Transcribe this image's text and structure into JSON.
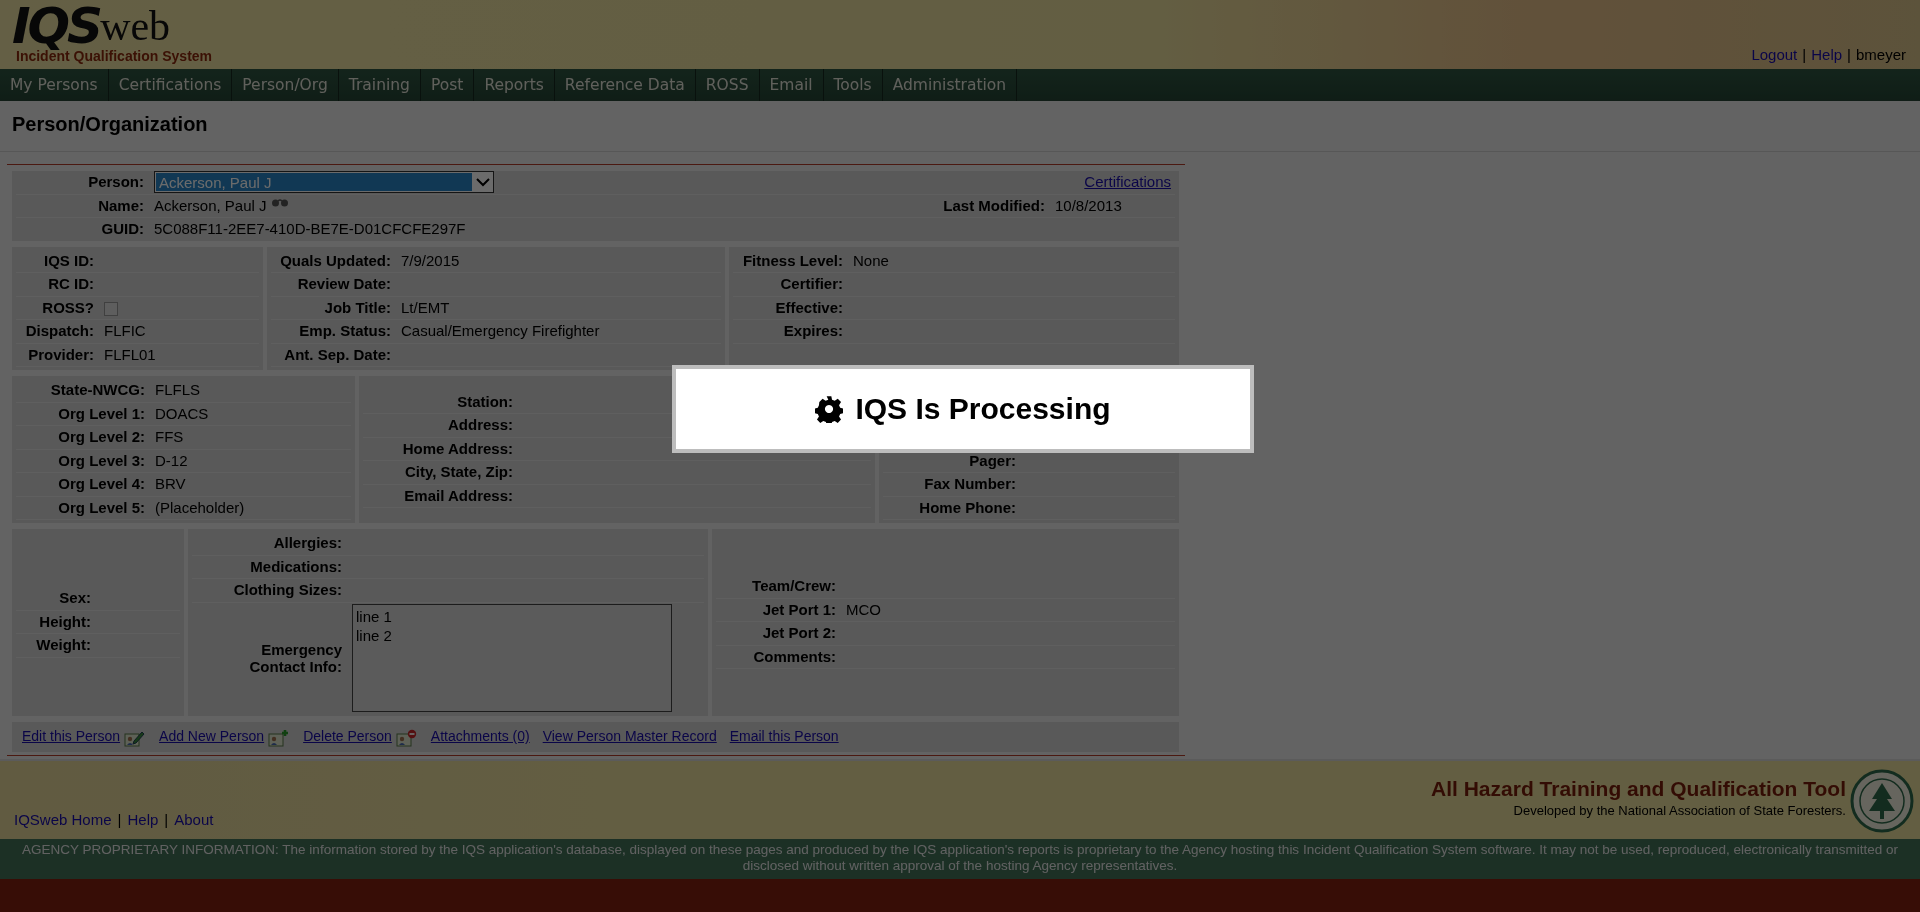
{
  "header": {
    "logo_mark": "IQS",
    "logo_word": "web",
    "logo_subtitle": "Incident Qualification System",
    "user_links": [
      {
        "label": "Logout",
        "kind": "link"
      },
      {
        "label": "|",
        "kind": "separator"
      },
      {
        "label": "Help",
        "kind": "link"
      },
      {
        "label": "|",
        "kind": "separator"
      },
      {
        "label": "bmeyer",
        "kind": "text"
      }
    ]
  },
  "nav": [
    {
      "label": "My Persons"
    },
    {
      "label": "Certifications"
    },
    {
      "label": "Person/Org"
    },
    {
      "label": "Training"
    },
    {
      "label": "Post"
    },
    {
      "label": "Reports"
    },
    {
      "label": "Reference Data"
    },
    {
      "label": "ROSS"
    },
    {
      "label": "Email"
    },
    {
      "label": "Tools"
    },
    {
      "label": "Administration"
    }
  ],
  "page_title": "Person/Organization",
  "person_panel": {
    "person_label": "Person:",
    "person_value": "Ackerson, Paul J",
    "certifications_link": "Certifications",
    "name_label": "Name:",
    "name_value": "Ackerson, Paul J",
    "last_modified_label": "Last Modified:",
    "last_modified_value": "10/8/2013",
    "guid_label": "GUID:",
    "guid_value": "5C088F11-2EE7-410D-BE7E-D01CFCFE297F"
  },
  "sections": [
    {
      "columns": [
        {
          "rows": [
            {
              "label": "IQS ID:",
              "kind": "text"
            },
            {
              "label": "RC ID:",
              "kind": "text"
            },
            {
              "label": "ROSS?",
              "kind": "checkbox",
              "checked": false
            },
            {
              "label": "Dispatch:",
              "kind": "text",
              "value": "FLFIC"
            },
            {
              "label": "Provider:",
              "kind": "text",
              "value": "FLFL01"
            }
          ]
        },
        {
          "rows": [
            {
              "label": "Quals Updated:",
              "kind": "text",
              "value": "7/9/2015"
            },
            {
              "label": "Review Date:",
              "kind": "text"
            },
            {
              "label": "Job Title:",
              "kind": "text",
              "value": "Lt/EMT"
            },
            {
              "label": "Emp. Status:",
              "kind": "text",
              "value": "Casual/Emergency Firefighter"
            },
            {
              "label": "Ant. Sep. Date:",
              "kind": "text"
            }
          ]
        },
        {
          "rows": [
            {
              "label": "Fitness Level:",
              "kind": "text",
              "value": "None"
            },
            {
              "label": "Certifier:",
              "kind": "text"
            },
            {
              "label": "Effective:",
              "kind": "text"
            },
            {
              "label": "Expires:",
              "kind": "text"
            }
          ]
        }
      ]
    },
    {
      "columns": [
        {
          "rows": [
            {
              "label": "State-NWCG:",
              "kind": "text",
              "value": "FLFLS"
            },
            {
              "label": "Org Level 1:",
              "kind": "text",
              "value": "DOACS"
            },
            {
              "label": "Org Level 2:",
              "kind": "text",
              "value": "FFS"
            },
            {
              "label": "Org Level 3:",
              "kind": "text",
              "value": "D-12"
            },
            {
              "label": "Org Level 4:",
              "kind": "text",
              "value": "BRV"
            },
            {
              "label": "Org Level 5:",
              "kind": "text",
              "value": "(Placeholder)"
            }
          ]
        },
        {
          "rows": [
            {
              "label": "Station:",
              "kind": "text"
            },
            {
              "label": "Address:",
              "kind": "text"
            },
            {
              "label": "Home Address:",
              "kind": "text"
            },
            {
              "label": "City, State, Zip:",
              "kind": "text"
            },
            {
              "label": "Email Address:",
              "kind": "text"
            }
          ]
        },
        {
          "rows": [
            {
              "label": "Pager:",
              "kind": "text"
            },
            {
              "label": "Fax Number:",
              "kind": "text"
            },
            {
              "label": "Home Phone:",
              "kind": "text"
            }
          ]
        }
      ]
    },
    {
      "columns": [
        {
          "rows": [
            {
              "label": "Sex:",
              "kind": "text"
            },
            {
              "label": "Height:",
              "kind": "text"
            },
            {
              "label": "Weight:",
              "kind": "text"
            }
          ]
        },
        {
          "rows": [
            {
              "label": "Allergies:",
              "kind": "text"
            },
            {
              "label": "Medications:",
              "kind": "text"
            },
            {
              "label": "Clothing Sizes:",
              "kind": "text"
            },
            {
              "label": "Emergency Contact Info:",
              "kind": "textarea",
              "value": "line 1\nline 2"
            }
          ]
        },
        {
          "rows": [
            {
              "label": "Team/Crew:",
              "kind": "text"
            },
            {
              "label": "Jet Port 1:",
              "kind": "text",
              "value": "MCO"
            },
            {
              "label": "Jet Port 2:",
              "kind": "text"
            },
            {
              "label": "Comments:",
              "kind": "text"
            }
          ]
        }
      ]
    }
  ],
  "actions": [
    {
      "label": "Edit this Person",
      "kind": "edit"
    },
    {
      "label": "Add New Person",
      "kind": "add"
    },
    {
      "label": "Delete Person",
      "kind": "delete"
    },
    {
      "label": "Attachments (0)",
      "kind": "plain"
    },
    {
      "label": "View Person Master Record",
      "kind": "plain"
    },
    {
      "label": "Email this Person",
      "kind": "plain"
    }
  ],
  "footer": {
    "links": [
      {
        "label": "IQSweb Home",
        "kind": "link"
      },
      {
        "label": "|",
        "kind": "separator"
      },
      {
        "label": "Help",
        "kind": "link"
      },
      {
        "label": "|",
        "kind": "separator"
      },
      {
        "label": "About",
        "kind": "link"
      }
    ],
    "title": "All Hazard Training and Qualification Tool",
    "subtitle": "Developed by the National Association of State Foresters.",
    "legal": "AGENCY PROPRIETARY INFORMATION: The information stored by the IQS application's database, displayed on these pages and produced by the IQS application's reports is proprietary to the Agency hosting this Incident Qualification System software. It may not be used, reproduced, electronically transmitted or disclosed without written approval of the hosting Agency representatives."
  },
  "modal": {
    "message": "IQS Is Processing"
  }
}
